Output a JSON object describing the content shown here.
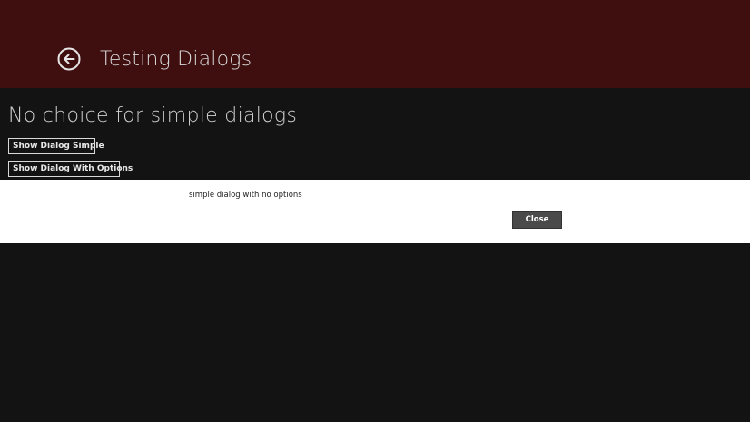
{
  "header": {
    "title": "Testing Dialogs",
    "back_icon": "arrow-left-circle-icon"
  },
  "main": {
    "section_title": "No choice for simple dialogs",
    "buttons": {
      "simple": "Show Dialog Simple",
      "with_options": "Show Dialog With Options"
    }
  },
  "dialog": {
    "message": "simple dialog with no options",
    "close_label": "Close"
  },
  "colors": {
    "header_bg": "#3f0e0f",
    "page_bg": "#131313",
    "dialog_bg": "#ffffff"
  }
}
